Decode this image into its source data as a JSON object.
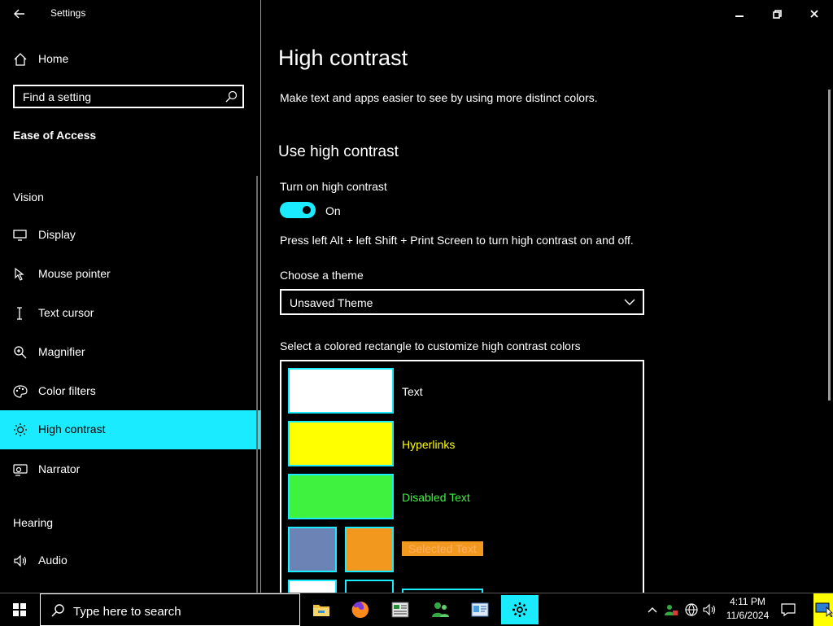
{
  "window": {
    "title": "Settings",
    "controls": [
      "minimize",
      "restore",
      "close"
    ]
  },
  "sidebar": {
    "home_label": "Home",
    "search_placeholder": "Find a setting",
    "category": "Ease of Access",
    "vision_heading": "Vision",
    "hearing_heading": "Hearing",
    "items": [
      {
        "label": "Display",
        "icon": "monitor-icon"
      },
      {
        "label": "Mouse pointer",
        "icon": "mouse-pointer-icon"
      },
      {
        "label": "Text cursor",
        "icon": "text-cursor-icon"
      },
      {
        "label": "Magnifier",
        "icon": "magnifier-icon"
      },
      {
        "label": "Color filters",
        "icon": "color-filters-icon"
      },
      {
        "label": "High contrast",
        "icon": "high-contrast-icon",
        "selected": true
      },
      {
        "label": "Narrator",
        "icon": "narrator-icon"
      }
    ],
    "hearing_items": [
      {
        "label": "Audio",
        "icon": "speaker-icon"
      }
    ]
  },
  "main": {
    "title": "High contrast",
    "description": "Make text and apps easier to see by using more distinct colors.",
    "section_title": "Use high contrast",
    "toggle_label": "Turn on high contrast",
    "toggle_state": "On",
    "toggle_on": true,
    "shortcut_text": "Press left Alt + left Shift + Print Screen to turn high contrast on and off.",
    "theme_label": "Choose a theme",
    "theme_value": "Unsaved Theme",
    "colors_label": "Select a colored rectangle to customize high contrast colors",
    "colors": [
      {
        "label": "Text",
        "color": "#ffffff",
        "label_color": "#ffffff"
      },
      {
        "label": "Hyperlinks",
        "color": "#ffff00",
        "label_color": "#ffff00"
      },
      {
        "label": "Disabled Text",
        "color": "#3ff23f",
        "label_color": "#3ff23f"
      },
      {
        "label": "Selected Text",
        "color_bg": "#6b83b5",
        "color_fg": "#f3981f",
        "label_bg": "#f3981f",
        "label_color": "#ffb060"
      }
    ]
  },
  "taskbar": {
    "search_placeholder": "Type here to search",
    "apps": [
      "file-explorer-icon",
      "firefox-icon",
      "document-app-icon",
      "people-app-icon",
      "control-panel-icon",
      "settings-gear-icon"
    ],
    "active_app": "settings-gear-icon",
    "time": "4:11 PM",
    "date": "11/6/2024"
  },
  "theme_colors": {
    "accent": "#1aebff",
    "background": "#000000",
    "text": "#ffffff"
  }
}
